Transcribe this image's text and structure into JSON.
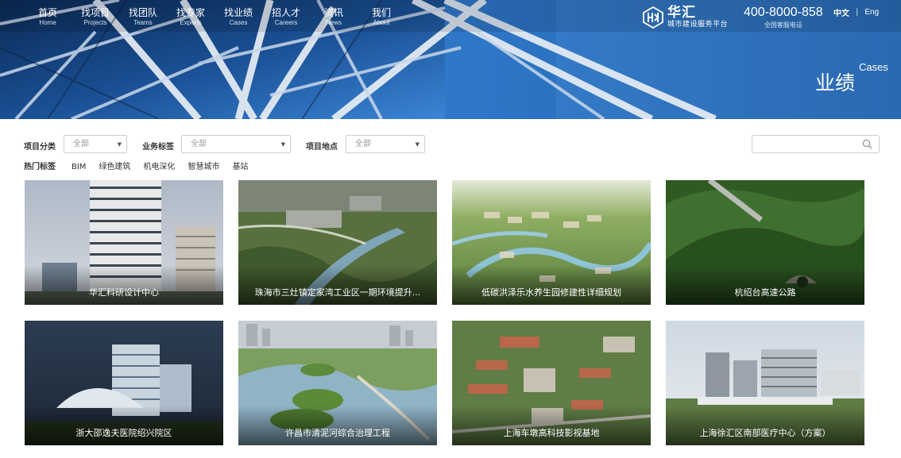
{
  "nav": [
    {
      "cn": "首页",
      "en": "Home"
    },
    {
      "cn": "找项目",
      "en": "Projects"
    },
    {
      "cn": "找团队",
      "en": "Teams"
    },
    {
      "cn": "找专家",
      "en": "Experts"
    },
    {
      "cn": "找业绩",
      "en": "Cases"
    },
    {
      "cn": "招人才",
      "en": "Careers"
    },
    {
      "cn": "资讯",
      "en": "News"
    },
    {
      "cn": "我们",
      "en": "About"
    }
  ],
  "brand": {
    "name": "华汇",
    "subtitle": "城市建设服务平台"
  },
  "hotline": {
    "number": "400-8000-858",
    "label": "全国客服电话"
  },
  "lang": {
    "zh": "中文",
    "separator": "|",
    "en": "Eng"
  },
  "hero": {
    "title_cn": "业绩",
    "title_en": "Cases"
  },
  "filters": [
    {
      "label": "项目分类",
      "value": "全部"
    },
    {
      "label": "业务标签",
      "value": "全部"
    },
    {
      "label": "项目地点",
      "value": "全部"
    }
  ],
  "search": {
    "placeholder": ""
  },
  "tags": {
    "label": "热门标签",
    "items": [
      "BIM",
      "绿色建筑",
      "机电深化",
      "智慧城市",
      "基站"
    ]
  },
  "cases": [
    "华汇科研设计中心",
    "珠海市三灶镇定家湾工业区一期环境提升...",
    "低碳洪泽乐水养生园修建性详细规划",
    "杭绍台高速公路",
    "浙大邵逸夫医院绍兴院区",
    "许昌市清泥河综合治理工程",
    "上海车墩高科技影视基地",
    "上海徐汇区南部医疗中心（方案）"
  ],
  "colors": {
    "banner_blue": "#2d78cc",
    "caption_text": "#ffffff",
    "label_text": "#333333",
    "placeholder_gray": "#999999"
  }
}
